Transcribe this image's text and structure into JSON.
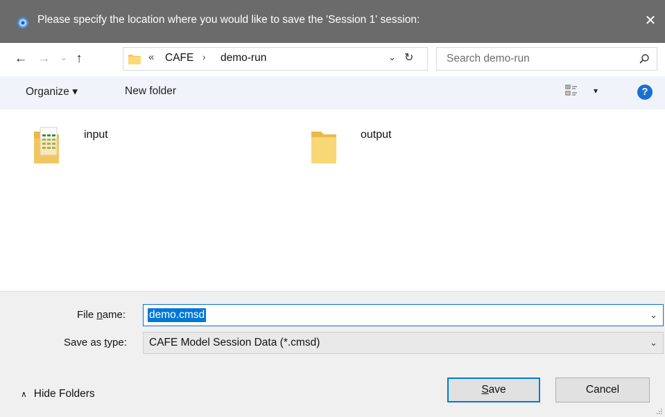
{
  "window": {
    "title": "Please specify the location where you would like to save the 'Session 1' session:",
    "close_glyph": "✕"
  },
  "nav": {
    "back_glyph": "←",
    "forward_glyph": "→",
    "recent_glyph": "⌄",
    "up_glyph": "↑"
  },
  "address": {
    "overflow_glyph": "«",
    "segments": [
      "CAFE",
      "demo-run"
    ],
    "separator_glyph": "›",
    "dropdown_glyph": "⌄",
    "refresh_glyph": "↻"
  },
  "search": {
    "placeholder": "Search demo-run"
  },
  "toolbar": {
    "organize_label": "Organize ▾",
    "new_folder_label": "New folder",
    "view_caret": "▾",
    "help_label": "?"
  },
  "files": [
    {
      "name": "input",
      "icon": "folder-with-spreadsheet-icon"
    },
    {
      "name": "output",
      "icon": "folder-icon"
    }
  ],
  "form": {
    "file_name_label_pre": "File ",
    "file_name_label_u": "n",
    "file_name_label_post": "ame:",
    "file_name_value": "demo.cmsd",
    "save_as_type_label_pre": "Save as ",
    "save_as_type_label_u": "t",
    "save_as_type_label_post": "ype:",
    "save_as_type_value": "CAFE Model Session Data (*.cmsd)",
    "combo_caret": "⌄"
  },
  "footer": {
    "hide_folders_caret": "∧",
    "hide_folders_label": "Hide Folders",
    "save_u": "S",
    "save_rest": "ave",
    "cancel_label": "Cancel"
  },
  "colors": {
    "titlebar": "#6b6b6b",
    "toolbar": "#f0f3f9",
    "accent": "#0078d7",
    "bottom_panel": "#f0f0f0"
  }
}
